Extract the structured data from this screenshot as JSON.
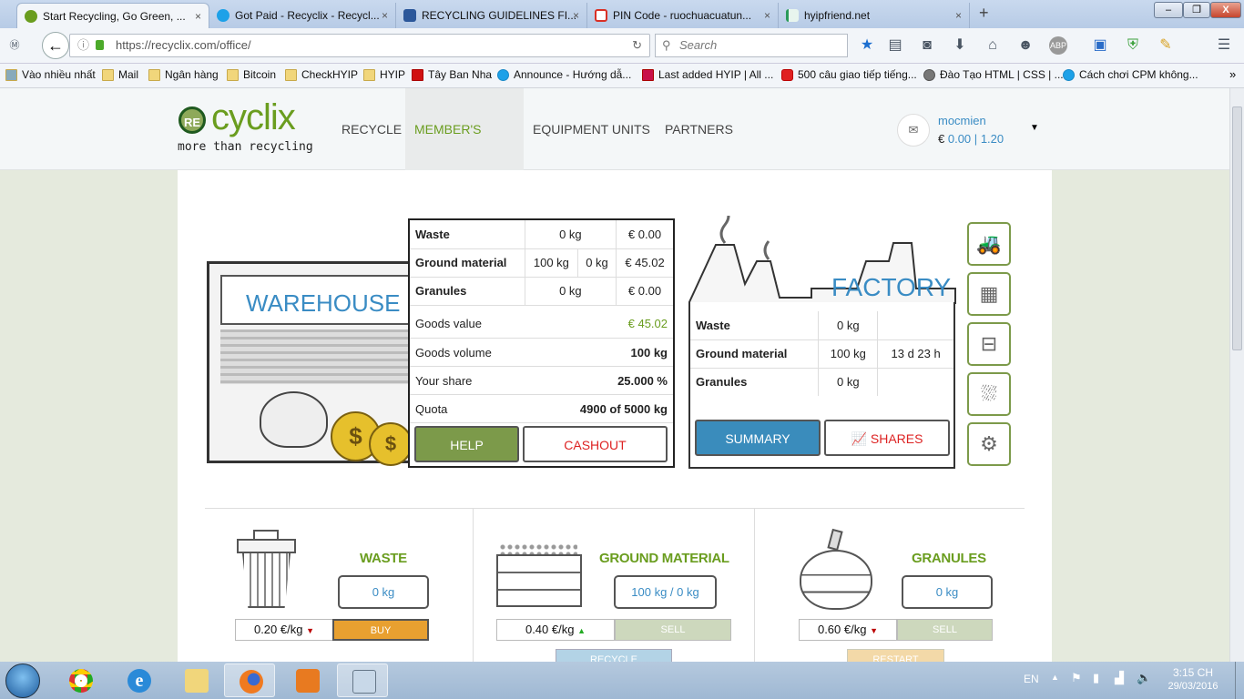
{
  "browser": {
    "tabs": [
      {
        "label": "Start Recycling, Go Green, ...",
        "active": true,
        "icon": "recyclix-icon",
        "color": "#6a9d1f"
      },
      {
        "label": "Got Paid - Recyclix - Recycl...",
        "icon": "skype-icon",
        "color": "#1da1e8"
      },
      {
        "label": "RECYCLING GUIDELINES FI...",
        "icon": "word-icon",
        "color": "#2b579a"
      },
      {
        "label": "PIN Code - ruochuacuatun...",
        "icon": "gmail-icon",
        "color": "#d93025"
      },
      {
        "label": "hyipfriend.net",
        "icon": "hyipfriend-icon",
        "color": "#2a9a5a"
      }
    ],
    "url": "https://recyclix.com/office/",
    "search_placeholder": "Search",
    "bookmarks": [
      "Vào nhiều nhất",
      "Mail",
      "Ngân hàng",
      "Bitcoin",
      "CheckHYIP",
      "HYIP",
      "Tây Ban Nha",
      "Announce - Hướng dẫ...",
      "Last added HYIP | All ...",
      "500 câu giao tiếp tiếng...",
      "Đào Tạo HTML | CSS | ...",
      "Cách chơi CPM không..."
    ]
  },
  "site": {
    "logo": {
      "re": "RE",
      "name": "cyclix",
      "tagline": "more than recycling"
    },
    "nav": [
      "RECYCLE",
      "MEMBER'S AREA",
      "EQUIPMENT UNITS",
      "PARTNERS"
    ],
    "active_nav": "MEMBER'S AREA",
    "user": {
      "name": "mocmien",
      "currency": "€",
      "balance": "0.00",
      "sep": "|",
      "second": "1.20"
    },
    "brand_color": "#6a9d1f"
  },
  "warehouse": {
    "label": "WAREHOUSE",
    "rows": [
      {
        "name": "Waste",
        "a": "0 kg",
        "price": "€ 0.00"
      },
      {
        "name": "Ground material",
        "a": "100 kg",
        "b": "0 kg",
        "price": "€ 45.02"
      },
      {
        "name": "Granules",
        "a": "0 kg",
        "price": "€ 0.00"
      }
    ],
    "stats": [
      {
        "label": "Goods value",
        "value": "€ 45.02"
      },
      {
        "label": "Goods volume",
        "value": "100 kg"
      },
      {
        "label": "Your share",
        "value": "25.000 %"
      },
      {
        "label": "Quota",
        "value": "4900 of 5000 kg"
      }
    ],
    "help": "HELP",
    "cashout": "CASHOUT"
  },
  "factory": {
    "label": "FACTORY",
    "rows": [
      {
        "name": "Waste",
        "a": "0 kg",
        "b": ""
      },
      {
        "name": "Ground material",
        "a": "100 kg",
        "b": "13 d 23 h"
      },
      {
        "name": "Granules",
        "a": "0 kg",
        "b": ""
      }
    ],
    "summary": "SUMMARY",
    "shares": "SHARES",
    "equipment_icons": [
      "forklift-icon",
      "control-panel-icon",
      "crusher-icon",
      "washer-icon",
      "granulator-icon"
    ]
  },
  "materials": [
    {
      "title": "WASTE",
      "qty": "0 kg",
      "price": "0.20 €/kg",
      "trend": "down",
      "action": "BUY",
      "action_color": "#e8a030",
      "extra": ""
    },
    {
      "title": "GROUND MATERIAL",
      "qty": "100 kg / 0 kg",
      "price": "0.40 €/kg",
      "trend": "up",
      "action": "SELL",
      "action_color": "#cdd8bd",
      "extra": "RECYCLE",
      "extra_color": "#b3d3e6"
    },
    {
      "title": "GRANULES",
      "qty": "0 kg",
      "price": "0.60 €/kg",
      "trend": "down",
      "action": "SELL",
      "action_color": "#cdd8bd",
      "extra": "RESTART",
      "extra_color": "#f3d9a8"
    }
  ],
  "taskbar": {
    "lang": "EN",
    "time": "3:15 CH",
    "date": "29/03/2016"
  }
}
